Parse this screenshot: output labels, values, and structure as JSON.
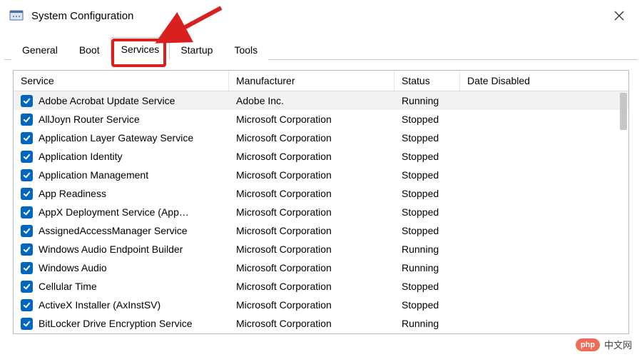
{
  "window": {
    "title": "System Configuration"
  },
  "tabs": {
    "items": [
      {
        "label": "General"
      },
      {
        "label": "Boot"
      },
      {
        "label": "Services"
      },
      {
        "label": "Startup"
      },
      {
        "label": "Tools"
      }
    ],
    "active_index": 2
  },
  "columns": {
    "service": "Service",
    "manufacturer": "Manufacturer",
    "status": "Status",
    "date_disabled": "Date Disabled"
  },
  "services": [
    {
      "checked": true,
      "name": "Adobe Acrobat Update Service",
      "manufacturer": "Adobe Inc.",
      "status": "Running",
      "date_disabled": "",
      "selected": true
    },
    {
      "checked": true,
      "name": "AllJoyn Router Service",
      "manufacturer": "Microsoft Corporation",
      "status": "Stopped",
      "date_disabled": ""
    },
    {
      "checked": true,
      "name": "Application Layer Gateway Service",
      "manufacturer": "Microsoft Corporation",
      "status": "Stopped",
      "date_disabled": ""
    },
    {
      "checked": true,
      "name": "Application Identity",
      "manufacturer": "Microsoft Corporation",
      "status": "Stopped",
      "date_disabled": ""
    },
    {
      "checked": true,
      "name": "Application Management",
      "manufacturer": "Microsoft Corporation",
      "status": "Stopped",
      "date_disabled": ""
    },
    {
      "checked": true,
      "name": "App Readiness",
      "manufacturer": "Microsoft Corporation",
      "status": "Stopped",
      "date_disabled": ""
    },
    {
      "checked": true,
      "name": "AppX Deployment Service (App…",
      "manufacturer": "Microsoft Corporation",
      "status": "Stopped",
      "date_disabled": ""
    },
    {
      "checked": true,
      "name": "AssignedAccessManager Service",
      "manufacturer": "Microsoft Corporation",
      "status": "Stopped",
      "date_disabled": ""
    },
    {
      "checked": true,
      "name": "Windows Audio Endpoint Builder",
      "manufacturer": "Microsoft Corporation",
      "status": "Running",
      "date_disabled": ""
    },
    {
      "checked": true,
      "name": "Windows Audio",
      "manufacturer": "Microsoft Corporation",
      "status": "Running",
      "date_disabled": ""
    },
    {
      "checked": true,
      "name": "Cellular Time",
      "manufacturer": "Microsoft Corporation",
      "status": "Stopped",
      "date_disabled": ""
    },
    {
      "checked": true,
      "name": "ActiveX Installer (AxInstSV)",
      "manufacturer": "Microsoft Corporation",
      "status": "Stopped",
      "date_disabled": ""
    },
    {
      "checked": true,
      "name": "BitLocker Drive Encryption Service",
      "manufacturer": "Microsoft Corporation",
      "status": "Running",
      "date_disabled": ""
    }
  ],
  "watermark": {
    "logo": "php",
    "text": "中文网"
  }
}
